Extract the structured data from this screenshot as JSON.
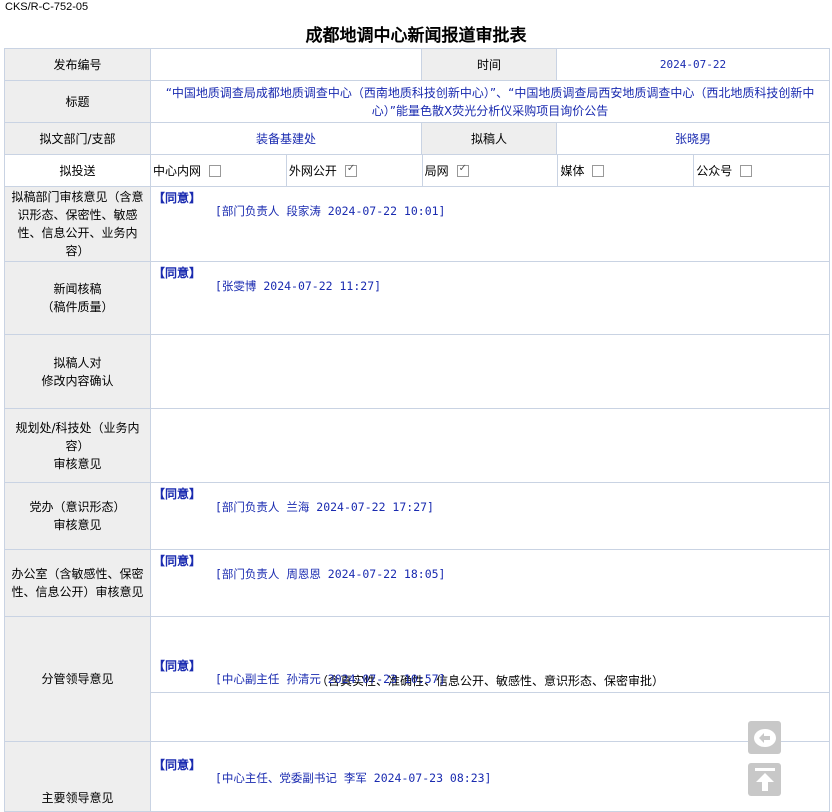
{
  "doc_code": "CKS/R-C-752-05",
  "title": "成都地调中心新闻报道审批表",
  "fields": {
    "pub_no_label": "发布编号",
    "pub_no_value": "",
    "time_label": "时间",
    "time_value": "2024-07-22",
    "title_label": "标题",
    "title_value": "“中国地质调查局成都地质调查中心（西南地质科技创新中心）”、“中国地质调查局西安地质调查中心（西北地质科技创新中心）”能量色散X荧光分析仪采购项目询价公告",
    "dept_label": "拟文部门/支部",
    "dept_value": "装备基建处",
    "drafter_label": "拟稿人",
    "drafter_value": "张晓男"
  },
  "send": {
    "label": "拟投送",
    "options": [
      {
        "label": "中心内网",
        "checked": false
      },
      {
        "label": "外网公开",
        "checked": true
      },
      {
        "label": "局网",
        "checked": true
      },
      {
        "label": "媒体",
        "checked": false
      },
      {
        "label": "公众号",
        "checked": false
      }
    ]
  },
  "rows": [
    {
      "label": "拟稿部门审核意见（含意识形态、保密性、敏感性、信息公开、业务内容）",
      "agree": "【同意】",
      "sign": "[部门负责人 段家涛 2024-07-22 10:01]"
    },
    {
      "label1": "新闻核稿",
      "label2": "（稿件质量）",
      "agree": "【同意】",
      "sign": "[张雯博 2024-07-22 11:27]"
    },
    {
      "label1": "拟稿人对",
      "label2": "修改内容确认",
      "agree": "",
      "sign": ""
    },
    {
      "label1": "规划处/科技处（业务内容）",
      "label2": "审核意见",
      "agree": "",
      "sign": ""
    },
    {
      "label1": "党办（意识形态）",
      "label2": "审核意见",
      "agree": "【同意】",
      "sign": "[部门负责人 兰海 2024-07-22 17:27]"
    },
    {
      "label": "办公室（含敏感性、保密性、信息公开）审核意见",
      "agree": "【同意】",
      "sign": "[部门负责人 周恩恩 2024-07-22 18:05]"
    },
    {
      "label": "分管领导意见",
      "note": "（含真实性、准确性、信息公开、敏感性、意识形态、保密审批）",
      "agree": "【同意】",
      "sign": "[中心副主任 孙清元 2024-07-23 10:57]"
    },
    {
      "label": "主要领导意见",
      "agree": "【同意】",
      "sign": "[中心主任、党委副书记 李军 2024-07-23 08:23]"
    }
  ],
  "icons": {
    "back": "back-arrow-icon",
    "top": "scroll-to-top-icon"
  }
}
